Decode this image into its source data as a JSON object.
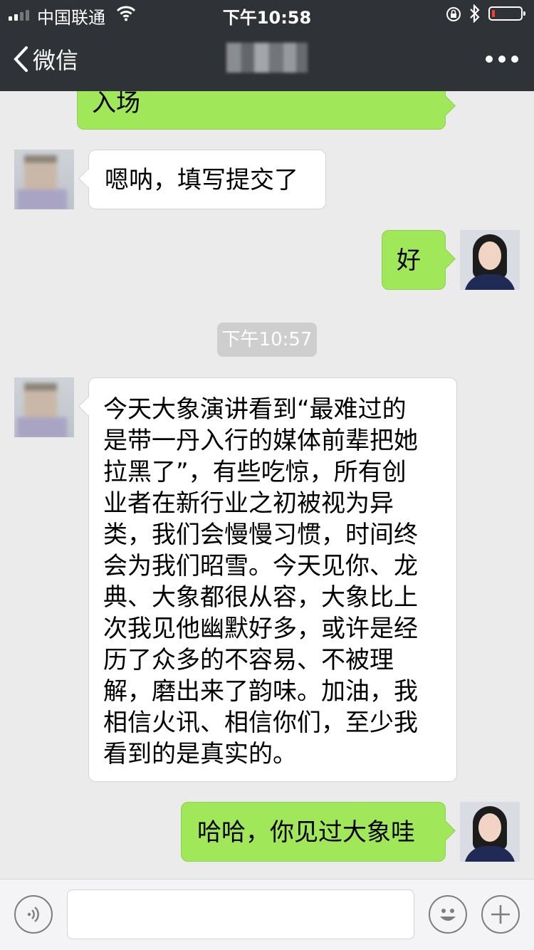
{
  "status_bar": {
    "carrier": "中国联通",
    "time": "下午10:58"
  },
  "nav": {
    "back_label": "微信"
  },
  "messages": [
    {
      "side": "right",
      "text": "入场"
    },
    {
      "side": "left",
      "text": "嗯呐，填写提交了"
    },
    {
      "side": "right",
      "text": "好"
    },
    {
      "side": "left",
      "lines": [
        "今天大象演讲看到“最难过的",
        "是带一丹入行的媒体前辈把她",
        "拉黑了”，有些吃惊，所有创",
        "业者在新行业之初被视为异",
        "类，我们会慢慢习惯，时间终",
        "会为我们昭雪。今天见你、龙",
        "典、大象都很从容，大象比上",
        "次我见他幽默好多，或许是经",
        "历了众多的不容易、不被理",
        "解，磨出来了韵味。加油，我",
        "相信火讯、相信你们，至少我",
        "看到的是真实的。"
      ]
    },
    {
      "side": "right",
      "text": "哈哈，你见过大象哇"
    }
  ],
  "timestamp": "下午10:57",
  "colors": {
    "nav_bg": "#2f3236",
    "chat_bg": "#ebebeb",
    "sent_bubble": "#a0e75a",
    "received_bubble": "#ffffff"
  }
}
